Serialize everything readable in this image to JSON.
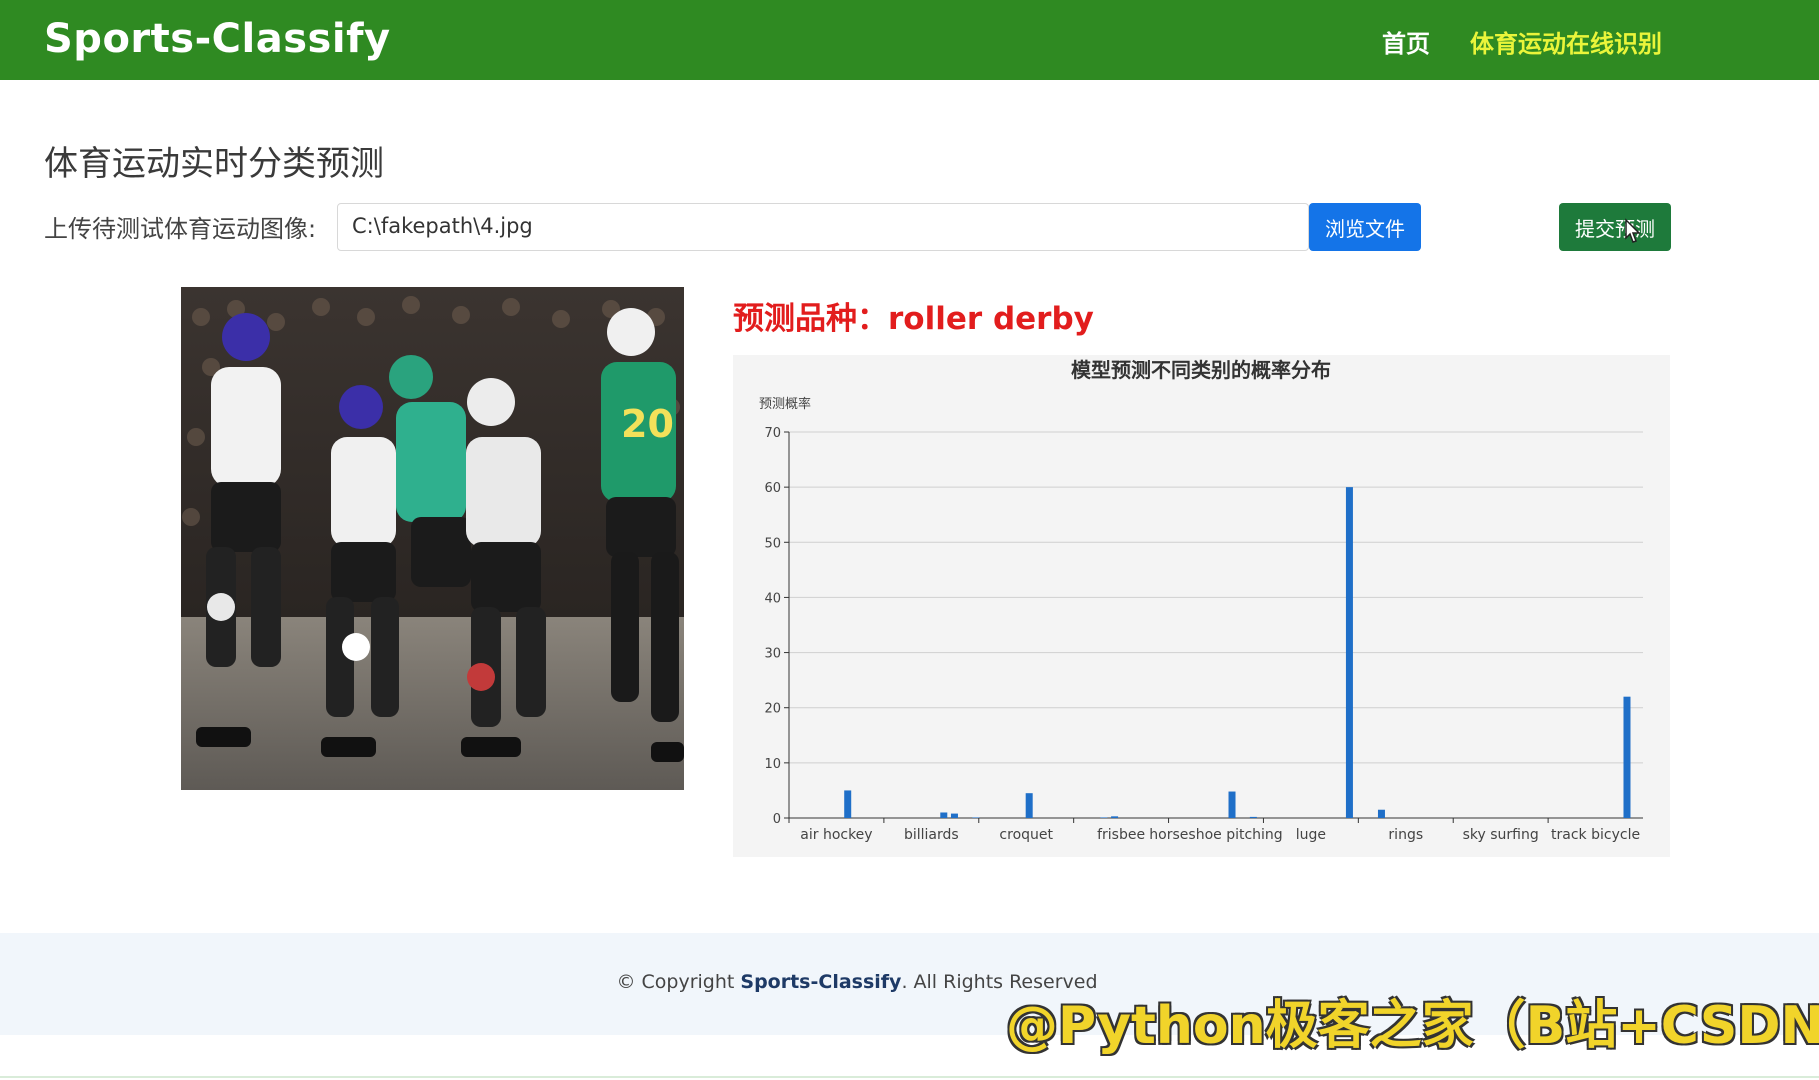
{
  "navbar": {
    "brand": "Sports-Classify",
    "links": [
      {
        "label": "首页"
      },
      {
        "label": "体育运动在线识别"
      }
    ],
    "bg_color": "#2f8a22",
    "active_color": "#eaf53a"
  },
  "main": {
    "title": "体育运动实时分类预测",
    "upload_label": "上传待测试体育运动图像:",
    "file_value": "C:\\fakepath\\4.jpg",
    "browse_label": "浏览文件",
    "submit_label": "提交预测",
    "prediction_label": "预测品种：roller derby"
  },
  "chart_data": {
    "type": "bar",
    "title": "模型预测不同类别的概率分布",
    "ylabel": "预测概率",
    "ylim": [
      0,
      70
    ],
    "yticks": [
      0,
      10,
      20,
      30,
      40,
      50,
      60,
      70
    ],
    "xtick_labels": [
      "air hockey",
      "billiards",
      "croquet",
      "frisbee",
      "horseshoe pitching",
      "luge",
      "rings",
      "sky surfing",
      "track bicycle"
    ],
    "values": [
      0,
      0,
      0,
      0,
      0,
      5,
      0,
      0,
      0,
      0,
      0,
      0,
      0,
      0,
      1,
      0.8,
      0,
      0.1,
      0,
      0,
      0,
      0,
      4.5,
      0,
      0,
      0,
      0,
      0,
      0,
      0.1,
      0.3,
      0,
      0,
      0,
      0,
      0,
      0,
      0,
      0,
      0,
      0,
      4.8,
      0,
      0.2,
      0,
      0,
      0,
      0,
      0,
      0,
      0,
      0,
      60,
      0,
      0,
      1.5,
      0,
      0,
      0,
      0,
      0,
      0,
      0,
      0,
      0,
      0,
      0,
      0,
      0,
      0,
      0,
      0,
      0,
      0,
      0,
      0,
      0,
      0,
      22,
      0
    ],
    "bar_color": "#1f6fc8",
    "grid": true
  },
  "footer": {
    "prefix": "© Copyright ",
    "brand": "Sports-Classify",
    "suffix": ". All Rights Reserved"
  },
  "watermark": "@Python极客之家（B站+CSDN）"
}
